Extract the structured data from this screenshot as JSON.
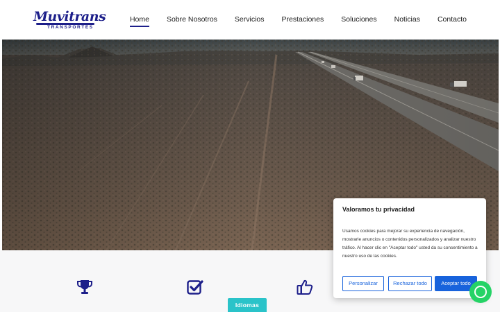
{
  "brand": {
    "name": "Muvitrans",
    "tagline": "TRANSPORTES",
    "color": "#1d1f8a"
  },
  "nav": {
    "items": [
      {
        "label": "Home",
        "active": true
      },
      {
        "label": "Sobre Nosotros",
        "active": false
      },
      {
        "label": "Servicios",
        "active": false
      },
      {
        "label": "Prestaciones",
        "active": false
      },
      {
        "label": "Soluciones",
        "active": false
      },
      {
        "label": "Noticias",
        "active": false
      },
      {
        "label": "Contacto",
        "active": false
      }
    ]
  },
  "features": {
    "icons": [
      "trophy-icon",
      "check-square-icon",
      "thumbs-up-icon"
    ],
    "icon_color": "#1d1f8a"
  },
  "language_button": {
    "label": "Idiomas",
    "color": "#2ac3c9"
  },
  "whatsapp": {
    "icon": "whatsapp-icon",
    "color": "#25d366"
  },
  "cookie_banner": {
    "title": "Valoramos tu privacidad",
    "text": "Usamos cookies para mejorar su experiencia de navegación, mostrarle anuncios o contenidos personalizados y analizar nuestro tráfico. Al hacer clic en \"Aceptar todo\" usted da su consentimiento a nuestro uso de las cookies.",
    "buttons": {
      "customize": "Personalizar",
      "reject": "Rechazar todo",
      "accept": "Aceptar todo"
    },
    "accent": "#1863dc"
  }
}
